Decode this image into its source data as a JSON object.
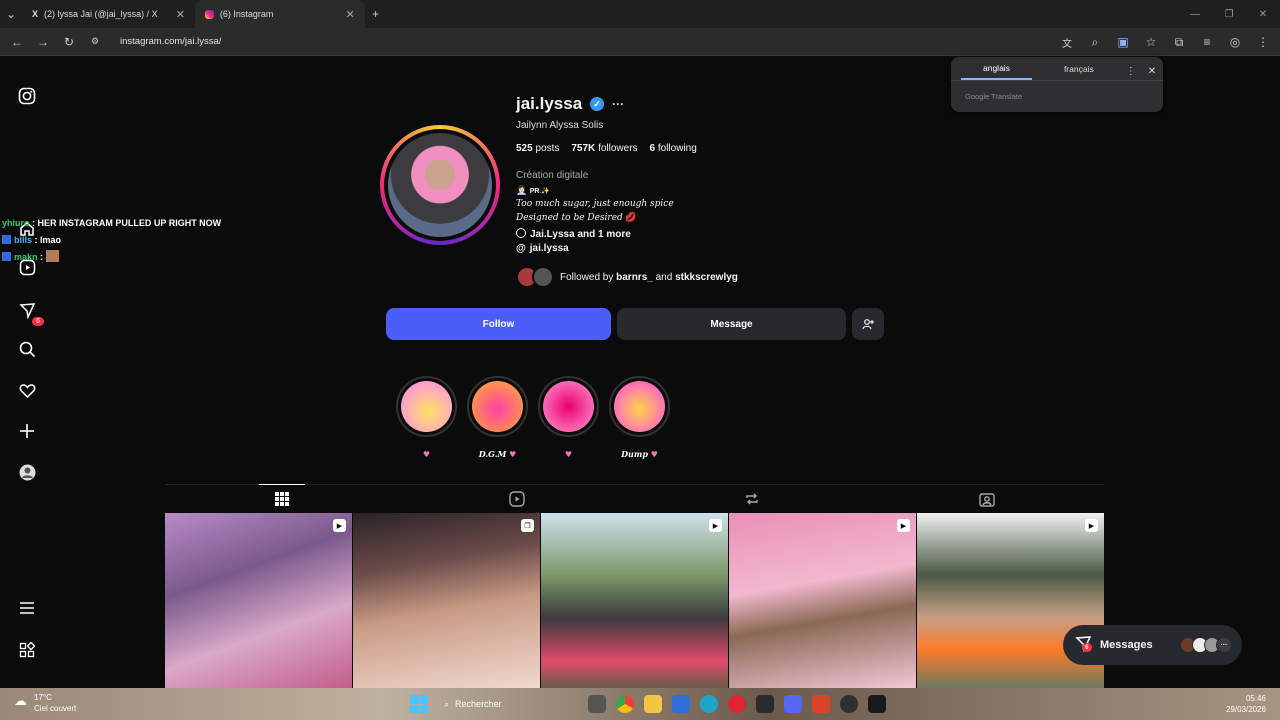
{
  "browser": {
    "tabs": [
      {
        "label": "(2) lyssa Jai (@jai_lyssa) / X",
        "icon": "x-logo-icon"
      },
      {
        "label": "(6) Instagram",
        "icon": "instagram-icon"
      }
    ],
    "new_tab": "+",
    "url": "instagram.com/jai.lyssa/"
  },
  "translate": {
    "tabs": [
      "anglais",
      "français"
    ],
    "footer": "Google Translate"
  },
  "chat_overlay": [
    {
      "user": "yhiuro",
      "message": "HER INSTAGRAM PULLED UP RIGHT NOW"
    },
    {
      "user": "bills",
      "message": "lmao"
    },
    {
      "user": "makn",
      "message": ""
    }
  ],
  "nav": {
    "notification_count": "6"
  },
  "profile": {
    "username": "jai.lyssa",
    "full_name": "Jailynn Alyssa Solis",
    "posts_count": "525",
    "posts_label": "posts",
    "followers_count": "757K",
    "followers_label": "followers",
    "following_count": "6",
    "following_label": "following",
    "category": "Création digitale",
    "bio_line1": "PR",
    "bio_line2": "Too much sugar, just enough spice",
    "bio_line3": "Designed to be Desired",
    "facebook_link": "Jai.Lyssa and 1 more",
    "threads_link": "jai.lyssa",
    "followed_by_prefix": "Followed by",
    "followed_by_1": "barnrs_",
    "followed_by_and": "and",
    "followed_by_2": "stkkscrewlyg"
  },
  "actions": {
    "follow": "Follow",
    "message": "Message"
  },
  "highlights": [
    {
      "label": "",
      "heart": "♥",
      "color_a": "#ffe066",
      "color_b": "#ff9ad5"
    },
    {
      "label": "D.G.M",
      "heart": "♥",
      "color_a": "#ff3fa8",
      "color_b": "#ff9d3f"
    },
    {
      "label": "",
      "heart": "♥",
      "color_a": "#e8006f",
      "color_b": "#ff7ac0"
    },
    {
      "label": "Dump",
      "heart": "♥",
      "color_a": "#ffd34d",
      "color_b": "#ff5fc8"
    }
  ],
  "messages_bar": {
    "label": "Messages",
    "badge": "6"
  },
  "taskbar": {
    "temperature": "17°C",
    "weather": "Ciel couvert",
    "search": "Rechercher",
    "time": "05:46",
    "date": "29/03/2026"
  },
  "colors": {
    "follow_button": "#4a5df9",
    "verified": "#3897f0",
    "badge": "#ff3040"
  }
}
